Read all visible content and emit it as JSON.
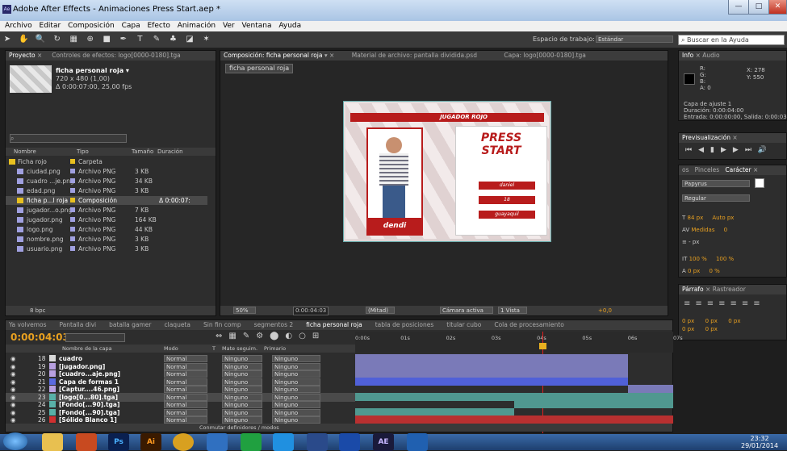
{
  "window": {
    "title": "Adobe After Effects - Animaciones Press Start.aep *",
    "icon_text": "Ae",
    "min": "—",
    "max": "□",
    "close": "✕"
  },
  "menu": [
    "Archivo",
    "Editar",
    "Composición",
    "Capa",
    "Efecto",
    "Animación",
    "Ver",
    "Ventana",
    "Ayuda"
  ],
  "workspace": {
    "label": "Espacio de trabajo:",
    "value": "Estándar",
    "search_placeholder": "Buscar en la Ayuda"
  },
  "project": {
    "tab1": "Proyecto",
    "tab2": "Controles de efectos: logo[0000-0180].tga",
    "item_name": "ficha personal roja ▾",
    "item_size": "720 x 480 (1,00)",
    "item_duration": "Δ 0:00:07:00, 25,00 fps",
    "col_name": "Nombre",
    "col_type": "Tipo",
    "col_size": "Tamaño",
    "col_duration": "Duración",
    "bpc": "8 bpc",
    "items": [
      {
        "name": "Ficha rojo",
        "type": "Carpeta",
        "size": "",
        "dur": "",
        "color": "#e8c020"
      },
      {
        "name": "ciudad.png",
        "type": "Archivo PNG",
        "size": "3 KB",
        "dur": "",
        "color": "#a0a0e0"
      },
      {
        "name": "cuadro ...je.png",
        "type": "Archivo PNG",
        "size": "34 KB",
        "dur": "",
        "color": "#a0a0e0"
      },
      {
        "name": "edad.png",
        "type": "Archivo PNG",
        "size": "3 KB",
        "dur": "",
        "color": "#a0a0e0"
      },
      {
        "name": "ficha p...l roja",
        "type": "Composición",
        "size": "",
        "dur": "Δ 0:00:07:",
        "color": "#e8c020"
      },
      {
        "name": "jugador...o.png",
        "type": "Archivo PNG",
        "size": "7 KB",
        "dur": "",
        "color": "#a0a0e0"
      },
      {
        "name": "jugador.png",
        "type": "Archivo PNG",
        "size": "164 KB",
        "dur": "",
        "color": "#a0a0e0"
      },
      {
        "name": "logo.png",
        "type": "Archivo PNG",
        "size": "44 KB",
        "dur": "",
        "color": "#a0a0e0"
      },
      {
        "name": "nombre.png",
        "type": "Archivo PNG",
        "size": "3 KB",
        "dur": "",
        "color": "#a0a0e0"
      },
      {
        "name": "usuario.png",
        "type": "Archivo PNG",
        "size": "3 KB",
        "dur": "",
        "color": "#a0a0e0"
      }
    ]
  },
  "comp": {
    "tab1": "Composición: ficha personal roja",
    "tab2": "Material de archivo: pantalla dividida.psd",
    "tab3": "Capa: logo[0000-0180].tga",
    "crumb": "ficha personal roja",
    "zoom": "50%",
    "time": "0:00:04:03",
    "quality": "(Mitad)",
    "camera": "Cámara activa",
    "views": "1 Vista",
    "offset": "+0,0",
    "card": {
      "header": "JUGADOR ROJO",
      "player_name": "dendi",
      "logo1": "PRESS",
      "logo2": "START",
      "field1": "daniel",
      "field2": "18",
      "field3": "guayaquil"
    }
  },
  "info": {
    "tab1": "Info",
    "tab2": "Audio",
    "r": "R:",
    "g": "G:",
    "b": "B:",
    "a": "A: 0",
    "x": "X: 278",
    "y": "Y: 550",
    "l1": "Capa de ajuste 1",
    "l2": "Duración: 0:00:04:00",
    "l3": "Entrada: 0:00:00:00, Salida: 0:00:03"
  },
  "preview": {
    "tab": "Previsualización"
  },
  "character": {
    "tab1": "os",
    "tab2": "Pinceles",
    "tab3": "Carácter",
    "font": "Papyrus",
    "style": "Regular",
    "size": "84 px",
    "leading": "Auto px",
    "kerning": "Medidas",
    "tracking": "0",
    "stroke": "- px",
    "vscale": "100 %",
    "hscale": "100 %",
    "baseline": "0 px",
    "tsume": "0 %"
  },
  "paragraph": {
    "tab1": "Párrafo",
    "tab2": "Rastreador",
    "i1": "0 px",
    "i2": "0 px",
    "i3": "0 px",
    "i4": "0 px",
    "i5": "0 px"
  },
  "timeline": {
    "tabs": [
      "Ya volvemos",
      "Pantalla divi",
      "batalla gamer",
      "claqueta",
      "Sin fin comp",
      "segmentos 2",
      "ficha personal roja",
      "tabla de posiciones",
      "titular cubo",
      "Cola de procesamiento"
    ],
    "time": "0:00:04:03",
    "col_layer": "Nombre de la capa",
    "col_mode": "Modo",
    "col_t": "T",
    "col_matte": "Mate seguim.",
    "col_parent": "Primario",
    "toggle": "Conmutar definidores / modos",
    "ruler": [
      "0:00s",
      "01s",
      "02s",
      "03s",
      "04s",
      "05s",
      "06s",
      "07s"
    ],
    "layers": [
      {
        "n": "18",
        "name": "cuadro",
        "color": "#d8d8d8",
        "mode": "Normal",
        "matte": "Ninguno",
        "parent": "Ninguno",
        "bar": "#7a7ab8",
        "start": 0,
        "end": 6
      },
      {
        "n": "19",
        "name": "[jugador.png]",
        "color": "#b8a0e0",
        "mode": "Normal",
        "matte": "Ninguno",
        "parent": "Ninguno",
        "bar": "#7a7ab8",
        "start": 0,
        "end": 6
      },
      {
        "n": "20",
        "name": "[cuadro...aje.png]",
        "color": "#b8a0e0",
        "mode": "Normal",
        "matte": "Ninguno",
        "parent": "Ninguno",
        "bar": "#7a7ab8",
        "start": 0,
        "end": 6
      },
      {
        "n": "21",
        "name": "Capa de formas 1",
        "color": "#5a6ae0",
        "mode": "Normal",
        "matte": "Ninguno",
        "parent": "Ninguno",
        "bar": "#5060d8",
        "start": 0,
        "end": 6
      },
      {
        "n": "22",
        "name": "[Captur....46.png]",
        "color": "#b8a0e0",
        "mode": "Normal",
        "matte": "Ninguno",
        "parent": "Ninguno",
        "bar": "#7a7ab8",
        "start": 6,
        "end": 7
      },
      {
        "n": "23",
        "name": "[logo[0...80].tga]",
        "color": "#58b0a8",
        "mode": "Normal",
        "matte": "Ninguno",
        "parent": "Ninguno",
        "bar": "#509890",
        "start": 0,
        "end": 7
      },
      {
        "n": "24",
        "name": "[Fondo[...90].tga]",
        "color": "#58b0a8",
        "mode": "Normal",
        "matte": "Ninguno",
        "parent": "Ninguno",
        "bar": "#509890",
        "start": 3.5,
        "end": 7
      },
      {
        "n": "25",
        "name": "[Fondo[...90].tga]",
        "color": "#58b0a8",
        "mode": "Normal",
        "matte": "Ninguno",
        "parent": "Ninguno",
        "bar": "#509890",
        "start": 0,
        "end": 3.5
      },
      {
        "n": "26",
        "name": "[Sólido Blanco 1]",
        "color": "#d03030",
        "mode": "Normal",
        "matte": "Ninguno",
        "parent": "Ninguno",
        "bar": "#b83030",
        "start": 0,
        "end": 7
      }
    ]
  },
  "taskbar": {
    "time": "23:32",
    "date": "29/01/2014",
    "apps": [
      "Ps",
      "Ai",
      "AE"
    ]
  }
}
